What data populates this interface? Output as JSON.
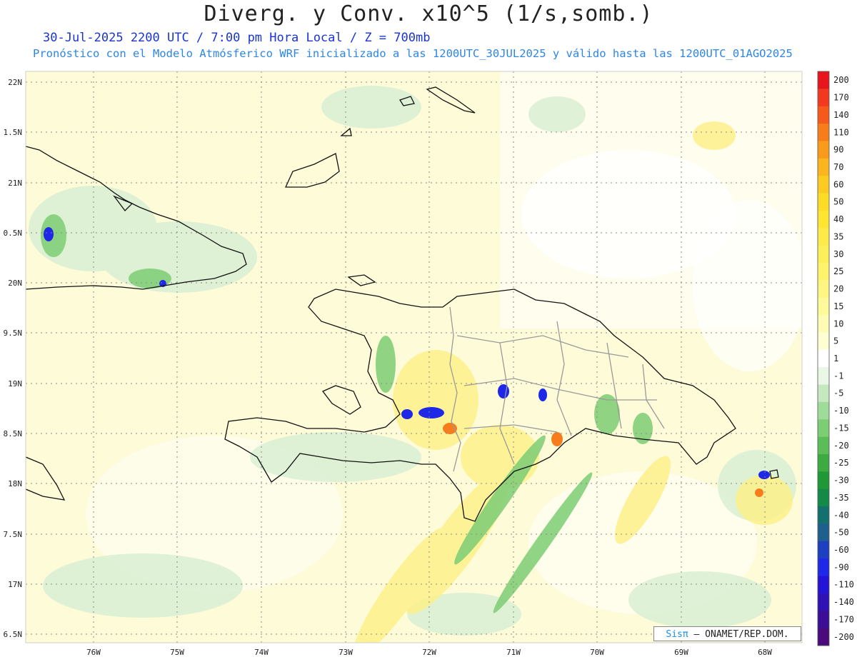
{
  "header": {
    "title": "Diverg. y Conv. x10^5 (1/s,somb.)",
    "date_line": "30-Jul-2025   2200 UTC / 7:00 pm Hora Local / Z = 700mb",
    "model_line": "Pronóstico con el Modelo Atmósferico WRF inicializado a las 1200UTC_30JUL2025 y válido hasta las  1200UTC_01AGO2025"
  },
  "map": {
    "lat_labels": [
      "22N",
      "1.5N",
      "21N",
      "0.5N",
      "20N",
      "9.5N",
      "19N",
      "8.5N",
      "18N",
      "7.5N",
      "17N",
      "6.5N"
    ],
    "lon_labels": [
      "76W",
      "75W",
      "74W",
      "73W",
      "72W",
      "71W",
      "70W",
      "69W",
      "68W"
    ]
  },
  "colorbar": {
    "labels": [
      "200",
      "170",
      "140",
      "110",
      "90",
      "70",
      "60",
      "50",
      "40",
      "35",
      "30",
      "25",
      "20",
      "15",
      "10",
      "5",
      "1",
      "-1",
      "-5",
      "-10",
      "-15",
      "-20",
      "-25",
      "-30",
      "-35",
      "-40",
      "-50",
      "-60",
      "-90",
      "-110",
      "-140",
      "-170",
      "-200"
    ],
    "colors": [
      "#e8141e",
      "#f2381e",
      "#f55a1c",
      "#f77d1c",
      "#f99a1c",
      "#fbb51e",
      "#fccb22",
      "#fddb26",
      "#fee532",
      "#fde94a",
      "#fcef5a",
      "#fdf36c",
      "#fdf682",
      "#fef99a",
      "#fefbb4",
      "#fffdd2",
      "#ffffff",
      "#eaf6e6",
      "#c6e8c0",
      "#9fdb99",
      "#7ccd74",
      "#5bbd57",
      "#3eab42",
      "#209836",
      "#138a48",
      "#13706e",
      "#1e5f8e",
      "#1e3fc2",
      "#1e28e6",
      "#2414d6",
      "#3012b4",
      "#3a0f96",
      "#4a0a7c"
    ]
  },
  "credit": {
    "brand": "Sisπ",
    "text": " – ONAMET/REP.DOM."
  }
}
